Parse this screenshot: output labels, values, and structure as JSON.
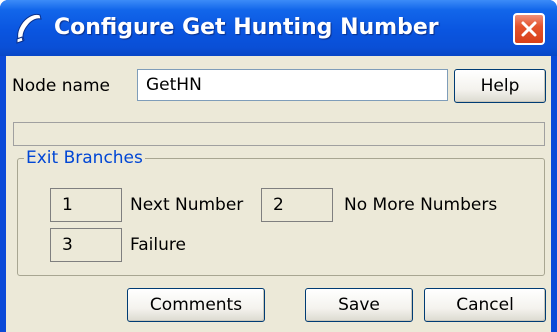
{
  "window": {
    "title": "Configure Get Hunting Number",
    "app_icon": "phone-handset-icon",
    "close_icon": "close-icon",
    "accent_color": "#0a55e0",
    "close_color": "#e4542e"
  },
  "node": {
    "label": "Node name",
    "value": "GetHN",
    "help_label": "Help"
  },
  "exit_branches": {
    "title": "Exit Branches",
    "title_color": "#0046d5",
    "items": [
      {
        "number": "1",
        "label": "Next Number"
      },
      {
        "number": "2",
        "label": "No More Numbers"
      },
      {
        "number": "3",
        "label": "Failure"
      }
    ]
  },
  "buttons": {
    "comments": "Comments",
    "save": "Save",
    "cancel": "Cancel"
  }
}
